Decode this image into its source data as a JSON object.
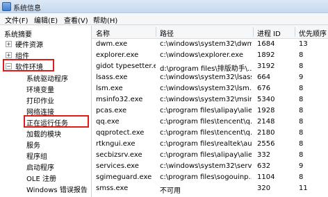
{
  "window": {
    "title": "系统信息"
  },
  "menubar": {
    "items": [
      {
        "label": "文件(F)"
      },
      {
        "label": "编辑(E)"
      },
      {
        "label": "查看(V)"
      },
      {
        "label": "帮助(H)"
      }
    ]
  },
  "tree": {
    "root": "系统摘要",
    "nodes": [
      {
        "label": "硬件资源",
        "expander": "+"
      },
      {
        "label": "组件",
        "expander": "+"
      },
      {
        "label": "软件环境",
        "expander": "−"
      }
    ],
    "children": [
      "系统驱动程序",
      "环境变量",
      "打印作业",
      "网络连接",
      "正在运行任务",
      "加载的模块",
      "服务",
      "程序组",
      "启动程序",
      "OLE 注册",
      "Windows 错误报告"
    ]
  },
  "table": {
    "columns": [
      "名称",
      "路径",
      "进程 ID",
      "优先顺序"
    ],
    "rows": [
      [
        "dwm.exe",
        "c:\\windows\\system32\\dwm...",
        "1684",
        "13"
      ],
      [
        "explorer.exe",
        "c:\\windows\\explorer.exe",
        "1892",
        "8"
      ],
      [
        "gidot typesetter.e...",
        "d:\\program files\\排版助手\\...",
        "3192",
        "8"
      ],
      [
        "lsass.exe",
        "c:\\windows\\system32\\lsass...",
        "664",
        "9"
      ],
      [
        "lsm.exe",
        "c:\\windows\\system32\\lsm.e...",
        "676",
        "8"
      ],
      [
        "msinfo32.exe",
        "c:\\windows\\system32\\msin...",
        "5340",
        "8"
      ],
      [
        "pcas.exe",
        "c:\\program files\\alipay\\alie...",
        "1928",
        "8"
      ],
      [
        "qq.exe",
        "c:\\program files\\tencent\\q...",
        "2148",
        "8"
      ],
      [
        "qqprotect.exe",
        "c:\\program files\\tencent\\q...",
        "2180",
        "8"
      ],
      [
        "rtkngui.exe",
        "c:\\program files\\realtek\\au...",
        "2556",
        "8"
      ],
      [
        "secbizsrv.exe",
        "c:\\program files\\alipay\\alie...",
        "332",
        "8"
      ],
      [
        "services.exe",
        "c:\\windows\\system32\\servi...",
        "632",
        "9"
      ],
      [
        "sgimeguard.exe",
        "c:\\program files\\sogouinp...",
        "1104",
        "8"
      ],
      [
        "smss.exe",
        "不可用",
        "320",
        "11"
      ]
    ]
  },
  "colors": {
    "highlight_box": "#e01a1a"
  }
}
